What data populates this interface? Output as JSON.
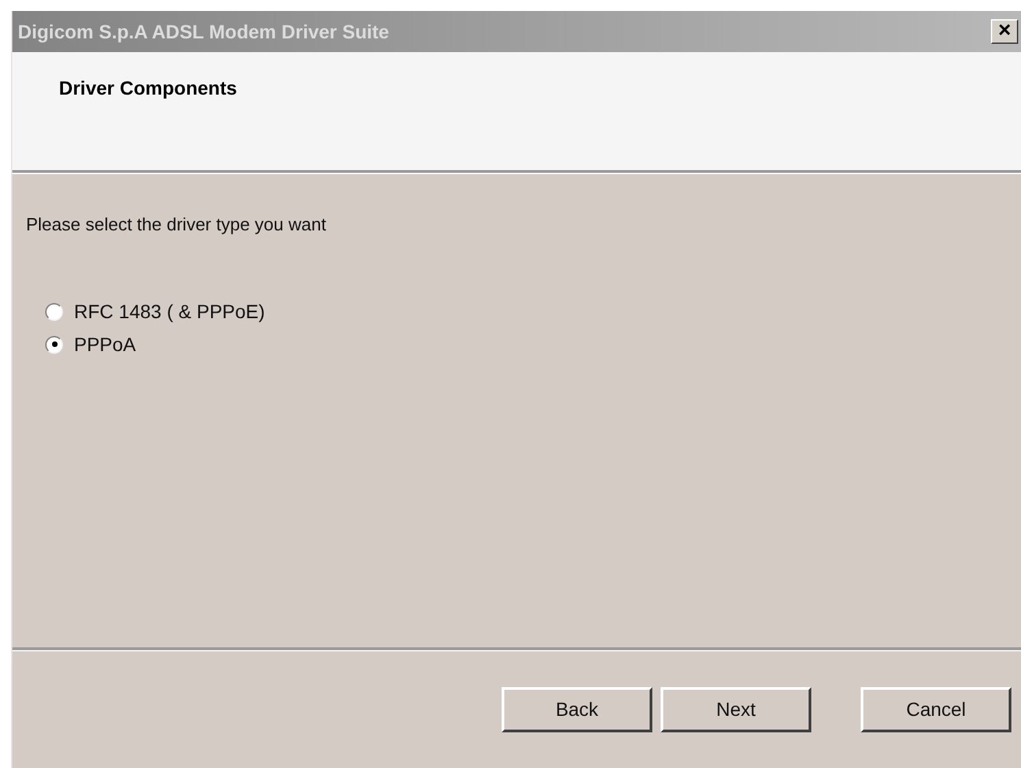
{
  "window": {
    "title": "Digicom S.p.A  ADSL Modem Driver Suite",
    "close": "×"
  },
  "header": {
    "title": "Driver Components"
  },
  "prompt": "Please select the driver type you want",
  "options": [
    {
      "label": "RFC 1483  ( & PPPoE)",
      "selected": false
    },
    {
      "label": "PPPoA",
      "selected": true
    }
  ],
  "buttons": [
    {
      "label": "Back"
    },
    {
      "label": "Next"
    },
    {
      "label": "Cancel"
    }
  ]
}
